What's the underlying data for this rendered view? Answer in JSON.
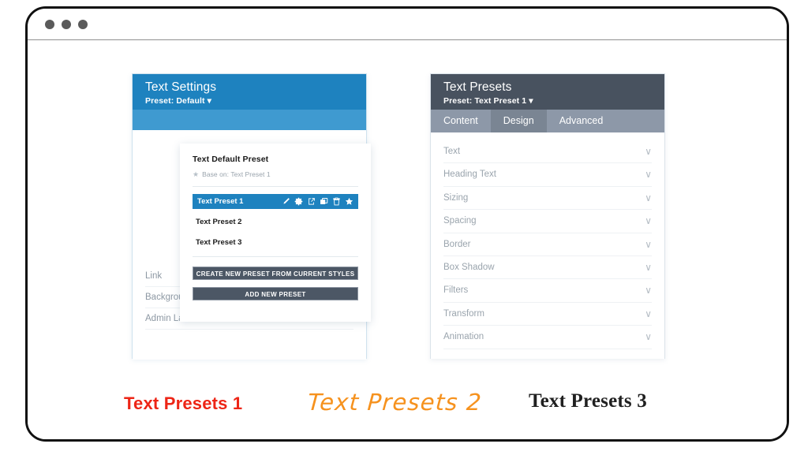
{
  "browser": {
    "dots": [
      "window-dot-1",
      "window-dot-2",
      "window-dot-3"
    ]
  },
  "left_panel": {
    "title": "Text Settings",
    "subtitle": "Preset: Default ▾",
    "popup": {
      "title": "Text Default Preset",
      "base_on": "Base on: Text Preset 1",
      "star_glyph": "★",
      "items": [
        {
          "label": "Text Preset 1",
          "active": true
        },
        {
          "label": "Text Preset 2",
          "active": false
        },
        {
          "label": "Text Preset 3",
          "active": false
        }
      ],
      "item_icons": [
        "pencil-icon",
        "gear-icon",
        "export-icon",
        "duplicate-icon",
        "trash-icon",
        "star-icon"
      ],
      "buttons": [
        "CREATE NEW PRESET FROM CURRENT STYLES",
        "ADD NEW PRESET"
      ]
    },
    "settings_rows": [
      "Link",
      "Background",
      "Admin Label"
    ]
  },
  "right_panel": {
    "title": "Text Presets",
    "subtitle": "Preset: Text Preset 1 ▾",
    "tabs": [
      {
        "label": "Content",
        "active": false
      },
      {
        "label": "Design",
        "active": true
      },
      {
        "label": "Advanced",
        "active": false
      }
    ],
    "sections": [
      "Text",
      "Heading Text",
      "Sizing",
      "Spacing",
      "Border",
      "Box Shadow",
      "Filters",
      "Transform",
      "Animation"
    ],
    "chevron_glyph": "∨"
  },
  "samples": [
    {
      "text": "Text Presets 1",
      "color": "#ed2516"
    },
    {
      "text": "Text Presets 2",
      "color": "#f6921e"
    },
    {
      "text": "Text Presets 3",
      "color": "#202020"
    }
  ],
  "colors": {
    "left_header_blue": "#1e82bf",
    "left_subheader_blue": "#3f9ad0",
    "right_header_slate": "#48525f",
    "tabbar_slate": "#8d98a8",
    "tab_active_slate": "#7a8593",
    "button_slate": "#4c5765"
  }
}
